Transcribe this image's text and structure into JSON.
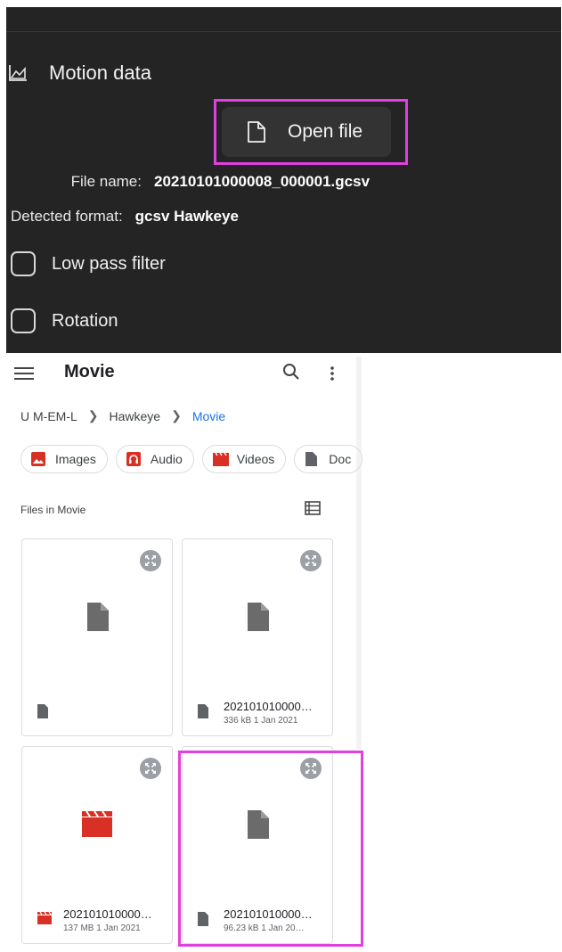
{
  "motion": {
    "section_title": "Motion data",
    "open_file_label": "Open file",
    "file_name_key": "File name:",
    "file_name_value": "20210101000008_000001.gcsv",
    "format_key": "Detected format:",
    "format_value": "gcsv Hawkeye",
    "low_pass_label": "Low pass filter",
    "rotation_label": "Rotation",
    "highlight_color": "#e040e0"
  },
  "picker": {
    "title": "Movie",
    "breadcrumb": [
      "U M-EM-L",
      "Hawkeye",
      "Movie"
    ],
    "chips": [
      {
        "label": "Images",
        "icon": "image-icon"
      },
      {
        "label": "Audio",
        "icon": "audio-icon"
      },
      {
        "label": "Videos",
        "icon": "video-icon"
      },
      {
        "label": "Doc",
        "icon": "document-icon"
      }
    ],
    "files_label": "Files in Movie",
    "files": [
      {
        "name": "",
        "meta": "",
        "type": "document"
      },
      {
        "name": "202101010000…",
        "meta": "336 kB 1 Jan 2021",
        "type": "document"
      },
      {
        "name": "202101010000…",
        "meta": "137 MB 1 Jan 2021",
        "type": "video"
      },
      {
        "name": "202101010000…",
        "meta": "96.23 kB 1 Jan 20…",
        "type": "document"
      }
    ],
    "accent_color": "#1a73e8",
    "media_color": "#d93025"
  }
}
